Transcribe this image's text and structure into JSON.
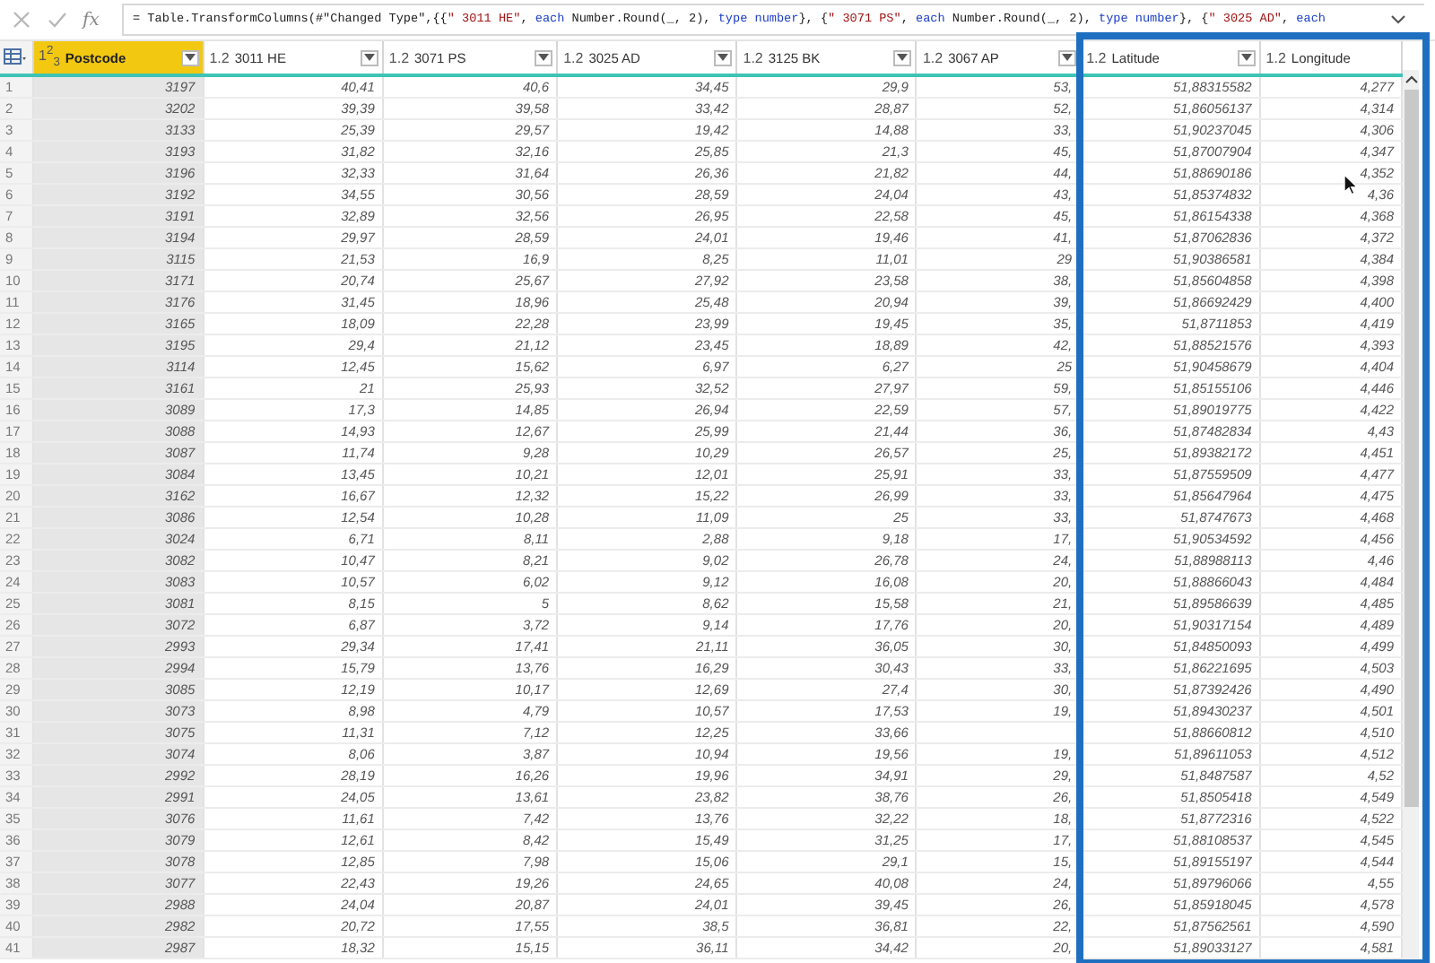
{
  "formula_bar": {
    "function_label": "fx",
    "parts": [
      {
        "kind": "plain",
        "text": "= Table.TransformColumns(#\"Changed Type\",{{"
      },
      {
        "kind": "string",
        "text": "\" 3011 HE\""
      },
      {
        "kind": "plain",
        "text": ", "
      },
      {
        "kind": "keyword",
        "text": "each"
      },
      {
        "kind": "plain",
        "text": " Number.Round(_, 2), "
      },
      {
        "kind": "keyword",
        "text": "type number"
      },
      {
        "kind": "plain",
        "text": "}, {"
      },
      {
        "kind": "string",
        "text": "\" 3071 PS\""
      },
      {
        "kind": "plain",
        "text": ", "
      },
      {
        "kind": "keyword",
        "text": "each"
      },
      {
        "kind": "plain",
        "text": " Number.Round(_, 2), "
      },
      {
        "kind": "keyword",
        "text": "type number"
      },
      {
        "kind": "plain",
        "text": "}, {"
      },
      {
        "kind": "string",
        "text": "\" 3025 AD\""
      },
      {
        "kind": "plain",
        "text": ", "
      },
      {
        "kind": "keyword",
        "text": "each"
      }
    ]
  },
  "table": {
    "columns": [
      {
        "type": "1$^{2}$$_{3}$",
        "name": "Postcode",
        "selected": true,
        "menu_button": true
      },
      {
        "type": "1.2",
        "name": "3011 HE",
        "selected": false,
        "menu_button": true
      },
      {
        "type": "1.2",
        "name": "3071 PS",
        "selected": false,
        "menu_button": true
      },
      {
        "type": "1.2",
        "name": "3025 AD",
        "selected": false,
        "menu_button": true
      },
      {
        "type": "1.2",
        "name": "3125 BK",
        "selected": false,
        "menu_button": true
      },
      {
        "type": "1.2",
        "name": "3067 AP",
        "selected": false,
        "menu_button": true
      },
      {
        "type": "1.2",
        "name": "Latitude",
        "selected": false,
        "menu_button": true
      },
      {
        "type": "1.2",
        "name": "Longitude",
        "selected": false,
        "menu_button": false
      }
    ],
    "rows": [
      {
        "number": "1",
        "cells": [
          "3197",
          "40,41",
          "40,6",
          "34,45",
          "29,9",
          "53,",
          "51,88315582",
          "4,277"
        ]
      },
      {
        "number": "2",
        "cells": [
          "3202",
          "39,39",
          "39,58",
          "33,42",
          "28,87",
          "52,",
          "51,86056137",
          "4,314"
        ]
      },
      {
        "number": "3",
        "cells": [
          "3133",
          "25,39",
          "29,57",
          "19,42",
          "14,88",
          "33,",
          "51,90237045",
          "4,306"
        ]
      },
      {
        "number": "4",
        "cells": [
          "3193",
          "31,82",
          "32,16",
          "25,85",
          "21,3",
          "45,",
          "51,87007904",
          "4,347"
        ]
      },
      {
        "number": "5",
        "cells": [
          "3196",
          "32,33",
          "31,64",
          "26,36",
          "21,82",
          "44,",
          "51,88690186",
          "4,352"
        ]
      },
      {
        "number": "6",
        "cells": [
          "3192",
          "34,55",
          "30,56",
          "28,59",
          "24,04",
          "43,",
          "51,85374832",
          "4,36"
        ]
      },
      {
        "number": "7",
        "cells": [
          "3191",
          "32,89",
          "32,56",
          "26,95",
          "22,58",
          "45,",
          "51,86154338",
          "4,368"
        ]
      },
      {
        "number": "8",
        "cells": [
          "3194",
          "29,97",
          "28,59",
          "24,01",
          "19,46",
          "41,",
          "51,87062836",
          "4,372"
        ]
      },
      {
        "number": "9",
        "cells": [
          "3115",
          "21,53",
          "16,9",
          "8,25",
          "11,01",
          "29",
          "51,90386581",
          "4,384"
        ]
      },
      {
        "number": "10",
        "cells": [
          "3171",
          "20,74",
          "25,67",
          "27,92",
          "23,58",
          "38,",
          "51,85604858",
          "4,398"
        ]
      },
      {
        "number": "11",
        "cells": [
          "3176",
          "31,45",
          "18,96",
          "25,48",
          "20,94",
          "39,",
          "51,86692429",
          "4,400"
        ]
      },
      {
        "number": "12",
        "cells": [
          "3165",
          "18,09",
          "22,28",
          "23,99",
          "19,45",
          "35,",
          "51,8711853",
          "4,419"
        ]
      },
      {
        "number": "13",
        "cells": [
          "3195",
          "29,4",
          "21,12",
          "23,45",
          "18,89",
          "42,",
          "51,88521576",
          "4,393"
        ]
      },
      {
        "number": "14",
        "cells": [
          "3114",
          "12,45",
          "15,62",
          "6,97",
          "6,27",
          "25",
          "51,90458679",
          "4,404"
        ]
      },
      {
        "number": "15",
        "cells": [
          "3161",
          "21",
          "25,93",
          "32,52",
          "27,97",
          "59,",
          "51,85155106",
          "4,446"
        ]
      },
      {
        "number": "16",
        "cells": [
          "3089",
          "17,3",
          "14,85",
          "26,94",
          "22,59",
          "57,",
          "51,89019775",
          "4,422"
        ]
      },
      {
        "number": "17",
        "cells": [
          "3088",
          "14,93",
          "12,67",
          "25,99",
          "21,44",
          "36,",
          "51,87482834",
          "4,43"
        ]
      },
      {
        "number": "18",
        "cells": [
          "3087",
          "11,74",
          "9,28",
          "10,29",
          "26,57",
          "25,",
          "51,89382172",
          "4,451"
        ]
      },
      {
        "number": "19",
        "cells": [
          "3084",
          "13,45",
          "10,21",
          "12,01",
          "25,91",
          "33,",
          "51,87559509",
          "4,477"
        ]
      },
      {
        "number": "20",
        "cells": [
          "3162",
          "16,67",
          "12,32",
          "15,22",
          "26,99",
          "33,",
          "51,85647964",
          "4,475"
        ]
      },
      {
        "number": "21",
        "cells": [
          "3086",
          "12,54",
          "10,28",
          "11,09",
          "25",
          "33,",
          "51,8747673",
          "4,468"
        ]
      },
      {
        "number": "22",
        "cells": [
          "3024",
          "6,71",
          "8,11",
          "2,88",
          "9,18",
          "17,",
          "51,90534592",
          "4,456"
        ]
      },
      {
        "number": "23",
        "cells": [
          "3082",
          "10,47",
          "8,21",
          "9,02",
          "26,78",
          "24,",
          "51,88988113",
          "4,46"
        ]
      },
      {
        "number": "24",
        "cells": [
          "3083",
          "10,57",
          "6,02",
          "9,12",
          "16,08",
          "20,",
          "51,88866043",
          "4,484"
        ]
      },
      {
        "number": "25",
        "cells": [
          "3081",
          "8,15",
          "5",
          "8,62",
          "15,58",
          "21,",
          "51,89586639",
          "4,485"
        ]
      },
      {
        "number": "26",
        "cells": [
          "3072",
          "6,87",
          "3,72",
          "9,14",
          "17,76",
          "20,",
          "51,90317154",
          "4,489"
        ]
      },
      {
        "number": "27",
        "cells": [
          "2993",
          "29,34",
          "17,41",
          "21,11",
          "36,05",
          "30,",
          "51,84850093",
          "4,499"
        ]
      },
      {
        "number": "28",
        "cells": [
          "2994",
          "15,79",
          "13,76",
          "16,29",
          "30,43",
          "33,",
          "51,86221695",
          "4,503"
        ]
      },
      {
        "number": "29",
        "cells": [
          "3085",
          "12,19",
          "10,17",
          "12,69",
          "27,4",
          "30,",
          "51,87392426",
          "4,490"
        ]
      },
      {
        "number": "30",
        "cells": [
          "3073",
          "8,98",
          "4,79",
          "10,57",
          "17,53",
          "19,",
          "51,89430237",
          "4,501"
        ]
      },
      {
        "number": "31",
        "cells": [
          "3075",
          "11,31",
          "7,12",
          "12,25",
          "33,66",
          null,
          "51,88660812",
          "4,510"
        ]
      },
      {
        "number": "32",
        "cells": [
          "3074",
          "8,06",
          "3,87",
          "10,94",
          "19,56",
          "19,",
          "51,89611053",
          "4,512"
        ]
      },
      {
        "number": "33",
        "cells": [
          "2992",
          "28,19",
          "16,26",
          "19,96",
          "34,91",
          "29,",
          "51,8487587",
          "4,52"
        ]
      },
      {
        "number": "34",
        "cells": [
          "2991",
          "24,05",
          "13,61",
          "23,82",
          "38,76",
          "26,",
          "51,8505418",
          "4,549"
        ]
      },
      {
        "number": "35",
        "cells": [
          "3076",
          "11,61",
          "7,42",
          "13,76",
          "32,22",
          "18,",
          "51,8772316",
          "4,522"
        ]
      },
      {
        "number": "36",
        "cells": [
          "3079",
          "12,61",
          "8,42",
          "15,49",
          "31,25",
          "17,",
          "51,88108537",
          "4,545"
        ]
      },
      {
        "number": "37",
        "cells": [
          "3078",
          "12,85",
          "7,98",
          "15,06",
          "29,1",
          "15,",
          "51,89155197",
          "4,544"
        ]
      },
      {
        "number": "38",
        "cells": [
          "3077",
          "22,43",
          "19,26",
          "24,65",
          "40,08",
          "24,",
          "51,89796066",
          "4,55"
        ]
      },
      {
        "number": "39",
        "cells": [
          "2988",
          "24,04",
          "20,87",
          "24,01",
          "39,45",
          "26,",
          "51,85918045",
          "4,578"
        ]
      },
      {
        "number": "40",
        "cells": [
          "2982",
          "20,72",
          "17,55",
          "38,5",
          "36,81",
          "22,",
          "51,87562561",
          "4,590"
        ]
      },
      {
        "number": "41",
        "cells": [
          "2987",
          "18,32",
          "15,15",
          "36,11",
          "34,42",
          "20,",
          "51,89033127",
          "4,581"
        ]
      }
    ]
  }
}
